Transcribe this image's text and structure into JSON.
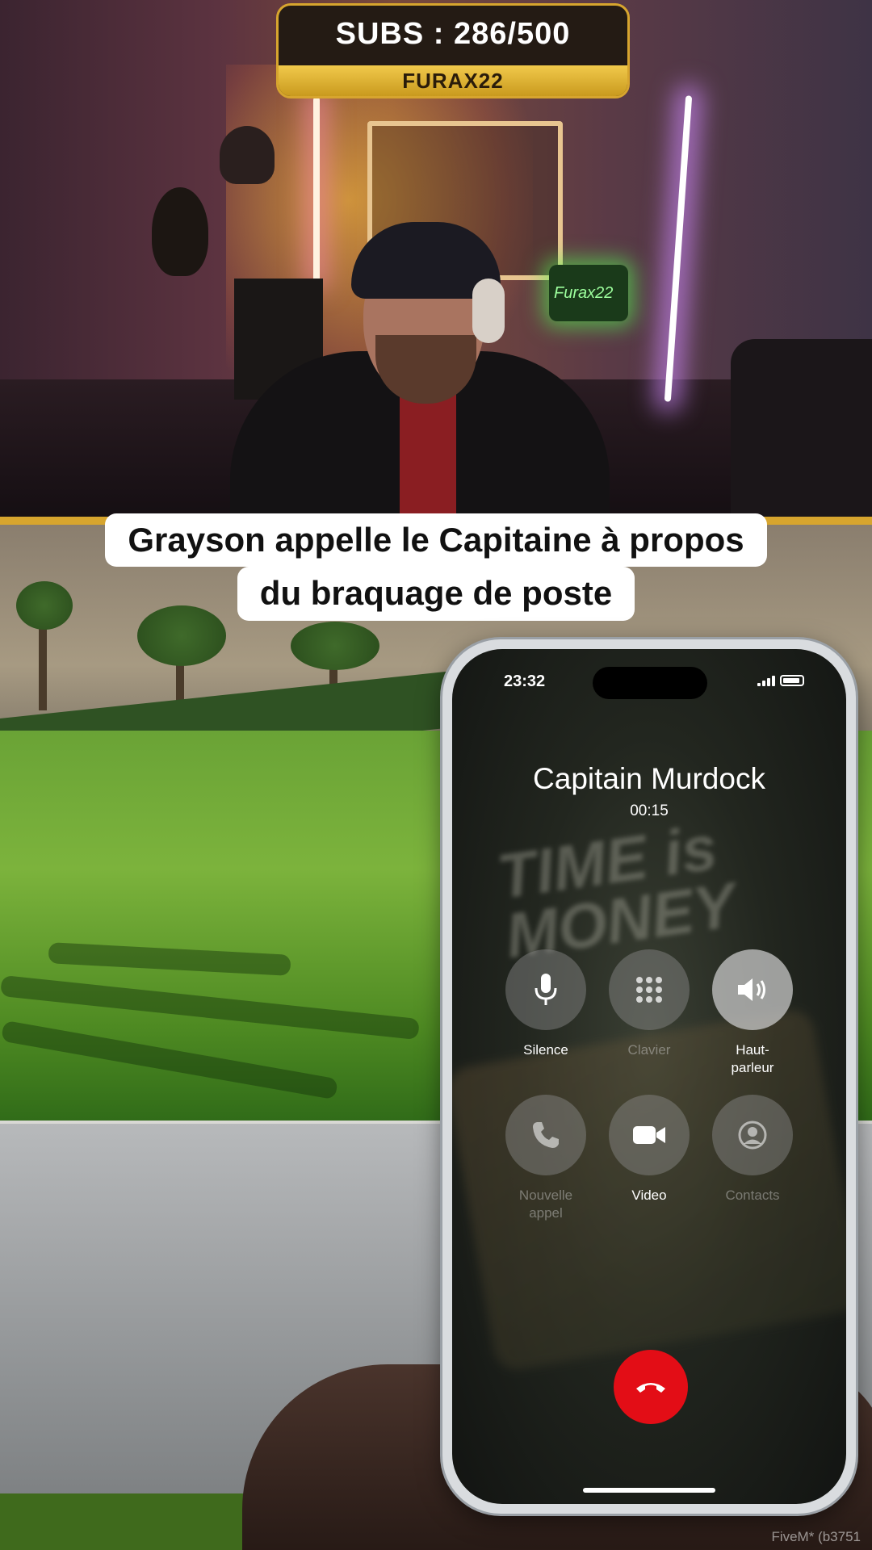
{
  "overlay": {
    "subs_text": "SUBS : 286/500",
    "streamer_name": "FURAX22",
    "neon_sign": "Furax22"
  },
  "caption": {
    "line1": "Grayson appelle le Capitaine à propos",
    "line2": "du braquage de poste"
  },
  "phone": {
    "status_time": "23:32",
    "caller_name": "Capitain Murdock",
    "call_duration": "00:15",
    "wallpaper_text": "TIME is MONEY",
    "buttons": [
      {
        "label": "Silence",
        "icon": "microphone-icon",
        "state": "normal"
      },
      {
        "label": "Clavier",
        "icon": "keypad-icon",
        "state": "disabled"
      },
      {
        "label": "Haut-parleur",
        "icon": "speaker-icon",
        "state": "active"
      },
      {
        "label": "Nouvelle appel",
        "icon": "phone-icon",
        "state": "disabled"
      },
      {
        "label": "Video",
        "icon": "video-camera-icon",
        "state": "normal"
      },
      {
        "label": "Contacts",
        "icon": "contacts-icon",
        "state": "disabled"
      }
    ],
    "end_call": {
      "icon": "hang-up-icon",
      "color": "#e30d16"
    }
  },
  "game": {
    "watermark": "FiveM* (b3751"
  },
  "colors": {
    "gold": "#d7a52e",
    "end_call_red": "#e30d16",
    "caption_bg": "#ffffff"
  }
}
